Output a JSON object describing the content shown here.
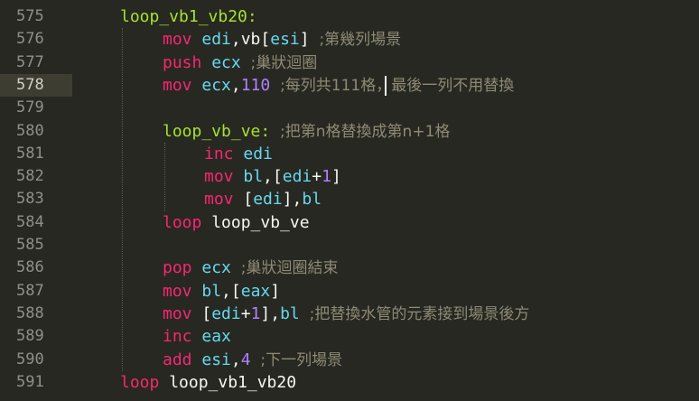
{
  "editor": {
    "lines": [
      {
        "n": "575",
        "tokens": [
          {
            "t": "loop_vb1_vb20:",
            "c": "label"
          }
        ]
      },
      {
        "n": "576",
        "tokens": [
          {
            "t": "mov ",
            "c": "kw"
          },
          {
            "t": "edi",
            "c": "reg"
          },
          {
            "t": ",vb[",
            "c": "plain"
          },
          {
            "t": "esi",
            "c": "reg"
          },
          {
            "t": "] ",
            "c": "plain"
          },
          {
            "t": ";第幾列場景",
            "c": "cmt"
          }
        ]
      },
      {
        "n": "577",
        "tokens": [
          {
            "t": "push ",
            "c": "kw"
          },
          {
            "t": "ecx ",
            "c": "reg"
          },
          {
            "t": ";巢狀迴圈",
            "c": "cmt"
          }
        ]
      },
      {
        "n": "578",
        "tokens": [
          {
            "t": "mov ",
            "c": "kw"
          },
          {
            "t": "ecx",
            "c": "reg"
          },
          {
            "t": ",",
            "c": "plain"
          },
          {
            "t": "110 ",
            "c": "num"
          },
          {
            "t": ";每列共111格，最後一列不用替換",
            "c": "cmt"
          }
        ]
      },
      {
        "n": "579",
        "tokens": []
      },
      {
        "n": "580",
        "tokens": [
          {
            "t": "loop_vb_ve: ",
            "c": "label"
          },
          {
            "t": ";把第n格替換成第n+1格",
            "c": "cmt"
          }
        ]
      },
      {
        "n": "581",
        "tokens": [
          {
            "t": "inc ",
            "c": "kw"
          },
          {
            "t": "edi",
            "c": "reg"
          }
        ]
      },
      {
        "n": "582",
        "tokens": [
          {
            "t": "mov ",
            "c": "kw"
          },
          {
            "t": "bl",
            "c": "reg"
          },
          {
            "t": ",[",
            "c": "plain"
          },
          {
            "t": "edi",
            "c": "reg"
          },
          {
            "t": "+",
            "c": "plain"
          },
          {
            "t": "1",
            "c": "num"
          },
          {
            "t": "]",
            "c": "plain"
          }
        ]
      },
      {
        "n": "583",
        "tokens": [
          {
            "t": "mov ",
            "c": "kw"
          },
          {
            "t": "[",
            "c": "plain"
          },
          {
            "t": "edi",
            "c": "reg"
          },
          {
            "t": "],",
            "c": "plain"
          },
          {
            "t": "bl",
            "c": "reg"
          }
        ]
      },
      {
        "n": "584",
        "tokens": [
          {
            "t": "loop ",
            "c": "kw"
          },
          {
            "t": "loop_vb_ve",
            "c": "plain"
          }
        ]
      },
      {
        "n": "585",
        "tokens": []
      },
      {
        "n": "586",
        "tokens": [
          {
            "t": "pop ",
            "c": "kw"
          },
          {
            "t": "ecx ",
            "c": "reg"
          },
          {
            "t": ";巢狀迴圈結束",
            "c": "cmt"
          }
        ]
      },
      {
        "n": "587",
        "tokens": [
          {
            "t": "mov ",
            "c": "kw"
          },
          {
            "t": "bl",
            "c": "reg"
          },
          {
            "t": ",[",
            "c": "plain"
          },
          {
            "t": "eax",
            "c": "reg"
          },
          {
            "t": "]",
            "c": "plain"
          }
        ]
      },
      {
        "n": "588",
        "tokens": [
          {
            "t": "mov ",
            "c": "kw"
          },
          {
            "t": "[",
            "c": "plain"
          },
          {
            "t": "edi",
            "c": "reg"
          },
          {
            "t": "+",
            "c": "plain"
          },
          {
            "t": "1",
            "c": "num"
          },
          {
            "t": "],",
            "c": "plain"
          },
          {
            "t": "bl ",
            "c": "reg"
          },
          {
            "t": ";把替換水管的元素接到場景後方",
            "c": "cmt"
          }
        ]
      },
      {
        "n": "589",
        "tokens": [
          {
            "t": "inc ",
            "c": "kw"
          },
          {
            "t": "eax",
            "c": "reg"
          }
        ]
      },
      {
        "n": "590",
        "tokens": [
          {
            "t": "add ",
            "c": "kw"
          },
          {
            "t": "esi",
            "c": "reg"
          },
          {
            "t": ",",
            "c": "plain"
          },
          {
            "t": "4 ",
            "c": "num"
          },
          {
            "t": ";下一列場景",
            "c": "cmt"
          }
        ]
      },
      {
        "n": "591",
        "tokens": [
          {
            "t": "loop ",
            "c": "kw"
          },
          {
            "t": "loop_vb1_vb20",
            "c": "plain"
          }
        ]
      }
    ],
    "active_line": "578",
    "colors": {
      "background": "#272822",
      "label": "#A6E22E",
      "keyword": "#F92672",
      "register": "#66D9EF",
      "number": "#AE81FF",
      "comment": "#8F8A74"
    }
  }
}
